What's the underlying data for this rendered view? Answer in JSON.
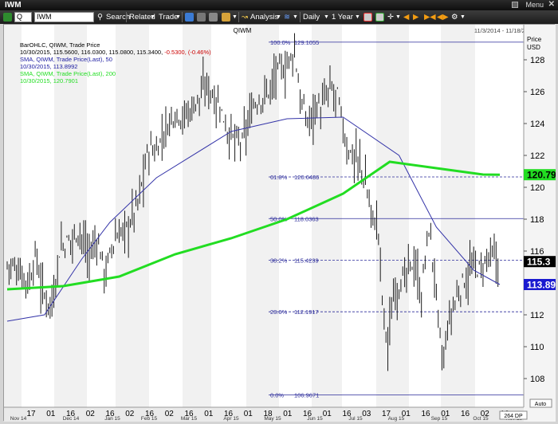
{
  "window": {
    "title": "IWM",
    "menu_label": "Menu",
    "close": "✕"
  },
  "toolbar": {
    "symbol_type": "Q",
    "symbol": "IWM",
    "search": "Search",
    "related": "Related",
    "trade": "Trade",
    "analysis": "Analysis",
    "frequency": "Daily",
    "range": "1 Year"
  },
  "chart": {
    "symbol_title": "QIWM",
    "date_range": "11/3/2014 - 11/18/2015 (EST)",
    "price_axis_label_1": "Price",
    "price_axis_label_2": "USD",
    "legend": [
      {
        "text": "BarOHLC, QIWM, Trade Price",
        "color": "#000000"
      },
      {
        "text": "10/30/2015, 115.5600, 116.0300, 115.0800, 115.3400, -0.5300, (-0.46%)",
        "color": "#000000",
        "neg": "-0.5300, (-0.46%)"
      },
      {
        "text": "SMA, QIWM, Trade Price(Last),  50",
        "color": "#1a1aa0"
      },
      {
        "text": "10/30/2015, 113.8992",
        "color": "#1a1aa0"
      },
      {
        "text": "SMA, QIWM, Trade Price(Last),  200",
        "color": "#22dd22"
      },
      {
        "text": "10/30/2015, 120.7901",
        "color": "#22dd22"
      }
    ],
    "fib_levels": [
      {
        "pct": "100.0%",
        "value": "129.1055",
        "price": 129.1055
      },
      {
        "pct": "61.8%",
        "value": "120.6486",
        "price": 120.6486
      },
      {
        "pct": "50.0%",
        "value": "118.0363",
        "price": 118.0363
      },
      {
        "pct": "38.2%",
        "value": "115.4239",
        "price": 115.4239
      },
      {
        "pct": "23.6%",
        "value": "112.1917",
        "price": 112.1917
      },
      {
        "pct": "0.0%",
        "value": "106.9671",
        "price": 106.9671
      }
    ],
    "price_ticks": [
      "128",
      "126",
      "124",
      "122",
      "120",
      "118",
      "116",
      "114",
      "112",
      "110",
      "108"
    ],
    "price_tick_values": [
      128,
      126,
      124,
      122,
      120,
      118,
      116,
      114,
      112,
      110,
      108
    ],
    "tags": [
      {
        "label": "120.79",
        "price": 120.79,
        "bg": "#22dd22",
        "fg": "#000000"
      },
      {
        "label": "115.3",
        "price": 115.34,
        "bg": "#000000",
        "fg": "#ffffff"
      },
      {
        "label": "113.89",
        "price": 113.9,
        "bg": "#1a1ad0",
        "fg": "#ffffff"
      }
    ],
    "x_ticks": [
      "17",
      "01",
      "16",
      "02",
      "16",
      "02",
      "16",
      "02",
      "16",
      "01",
      "16",
      "01",
      "18",
      "01",
      "16",
      "01",
      "16",
      "03",
      "17",
      "01",
      "16",
      "01",
      "16",
      "02",
      "16"
    ],
    "months": [
      "Nov 14",
      "Dec 14",
      "Jan 15",
      "Feb 15",
      "Mar 15",
      "Apr 15",
      "May 15",
      "Jun 15",
      "Jul 15",
      "Aug 15",
      "Sep 15",
      "Oct 15",
      "Nov 15"
    ],
    "footer": {
      "period": "264 DP",
      "auto": "Auto"
    },
    "colors": {
      "sma50": "#3434a8",
      "sma200": "#22dd22",
      "fib": "#2a2a9a",
      "bars": "#1a1a1a"
    }
  },
  "chart_data": {
    "type": "bar",
    "title": "QIWM",
    "ylabel": "Price USD",
    "ylim": [
      106.2,
      130.2
    ],
    "series": [
      {
        "name": "SMA, QIWM, Trade Price(Last), 50",
        "x_index": [
          0,
          20,
          40,
          55,
          80,
          120,
          150,
          180,
          210,
          230,
          250,
          264
        ],
        "values": [
          111.6,
          112.0,
          115.5,
          117.8,
          120.6,
          123.5,
          124.3,
          124.4,
          122.0,
          117.5,
          114.8,
          113.9
        ]
      },
      {
        "name": "SMA, QIWM, Trade Price(Last), 200",
        "x_index": [
          0,
          30,
          60,
          90,
          120,
          150,
          180,
          205,
          230,
          255,
          264
        ],
        "values": [
          113.6,
          113.8,
          114.4,
          115.8,
          116.8,
          118.0,
          119.6,
          121.6,
          121.2,
          120.8,
          120.79
        ]
      }
    ],
    "last_bar": {
      "date": "10/30/2015",
      "open": 115.56,
      "high": 116.03,
      "low": 115.08,
      "close": 115.34
    }
  }
}
